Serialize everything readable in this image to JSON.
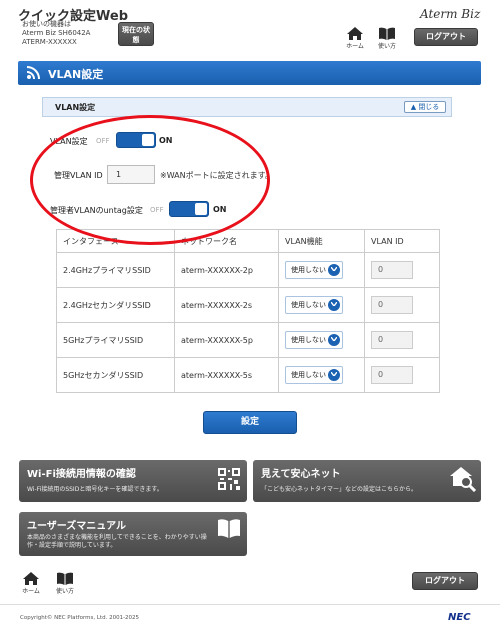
{
  "header": {
    "app_title": "クイック設定Web",
    "device_caption": "お使いの機器は",
    "device_model": "Aterm Biz SH6042A",
    "device_id": "ATERM-XXXXXX",
    "status_button": "現在の状態",
    "brand": "Aterm Biz",
    "home_label": "ホーム",
    "manual_label": "使い方",
    "logout_label": "ログアウト"
  },
  "page": {
    "title": "VLAN設定"
  },
  "section": {
    "title": "VLAN設定",
    "close_label": "閉じる"
  },
  "settings": {
    "vlan_label": "VLAN設定",
    "vlan_off": "OFF",
    "vlan_on": "ON",
    "mgmt_vlan_label": "管理VLAN ID",
    "mgmt_vlan_value": "1",
    "mgmt_vlan_note": "※WANポートに設定されます。",
    "untag_label": "管理者VLANのuntag設定",
    "untag_off": "OFF",
    "untag_on": "ON"
  },
  "table": {
    "headers": [
      "インタフェース",
      "ネットワーク名",
      "VLAN機能",
      "VLAN ID"
    ],
    "rows": [
      {
        "iface": "2.4GHzプライマリSSID",
        "net": "aterm-XXXXXX-2p",
        "func": "使用しない",
        "id": "0"
      },
      {
        "iface": "2.4GHzセカンダリSSID",
        "net": "aterm-XXXXXX-2s",
        "func": "使用しない",
        "id": "0"
      },
      {
        "iface": "5GHzプライマリSSID",
        "net": "aterm-XXXXXX-5p",
        "func": "使用しない",
        "id": "0"
      },
      {
        "iface": "5GHzセカンダリSSID",
        "net": "aterm-XXXXXX-5s",
        "func": "使用しない",
        "id": "0"
      }
    ]
  },
  "actions": {
    "set_label": "設定"
  },
  "cards": {
    "wifi_title": "Wi-Fi接続用情報の確認",
    "wifi_desc": "Wi-Fi接続用のSSIDと暗号化キーを確認できます。",
    "safety_title": "見えて安心ネット",
    "safety_desc": "「こども安心ネットタイマー」などの設定はこちらから。",
    "manual_title": "ユーザーズマニュアル",
    "manual_desc_1": "本商品のさまざまな機能を利用してできることを、わかりやすい操",
    "manual_desc_2": "作・設定手順で説明しています。"
  },
  "footer": {
    "home_label": "ホーム",
    "manual_label": "使い方",
    "logout_label": "ログアウト",
    "copyright": "Copyright© NEC Platforms, Ltd. 2001-2025",
    "maker": "NEC"
  },
  "colors": {
    "accent_blue": "#1a5fae",
    "annotation_red": "#e8101a",
    "dark_button": "#4a4a4a"
  }
}
